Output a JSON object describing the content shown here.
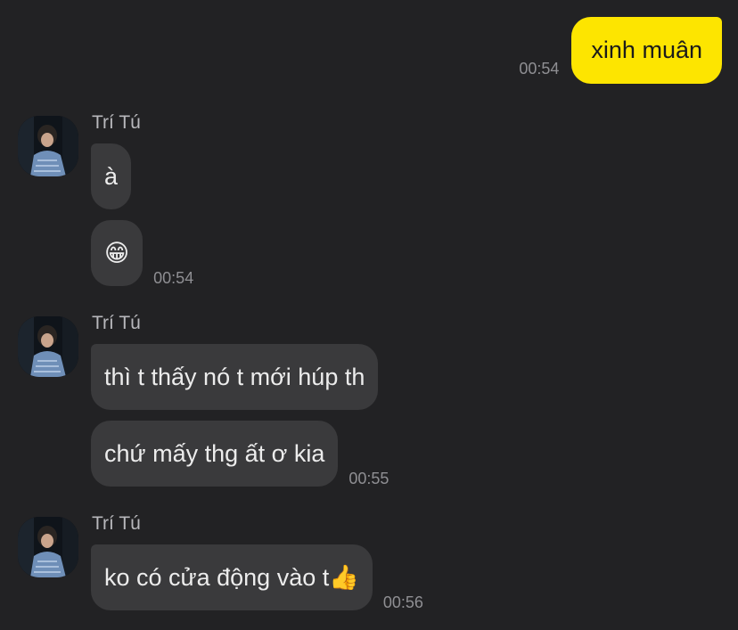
{
  "outgoing": [
    {
      "text": "xinh muân",
      "time": "00:54"
    }
  ],
  "groups": [
    {
      "sender": "Trí Tú",
      "messages": [
        {
          "text": "à",
          "time": ""
        },
        {
          "text": "😁",
          "time": "00:54"
        }
      ]
    },
    {
      "sender": "Trí Tú",
      "messages": [
        {
          "text": "thì t thấy nó t mới húp th",
          "time": ""
        },
        {
          "text": "chứ mấy thg ất ơ kia",
          "time": "00:55"
        }
      ]
    },
    {
      "sender": "Trí Tú",
      "messages": [
        {
          "text": "ko có cửa động vào t👍",
          "time": "00:56"
        }
      ]
    }
  ],
  "colors": {
    "background": "#222224",
    "outgoing_bubble": "#fde500",
    "incoming_bubble": "#3a3a3c",
    "timestamp": "#8f8f93"
  },
  "icons": {
    "avatar": "avatar-icon"
  }
}
